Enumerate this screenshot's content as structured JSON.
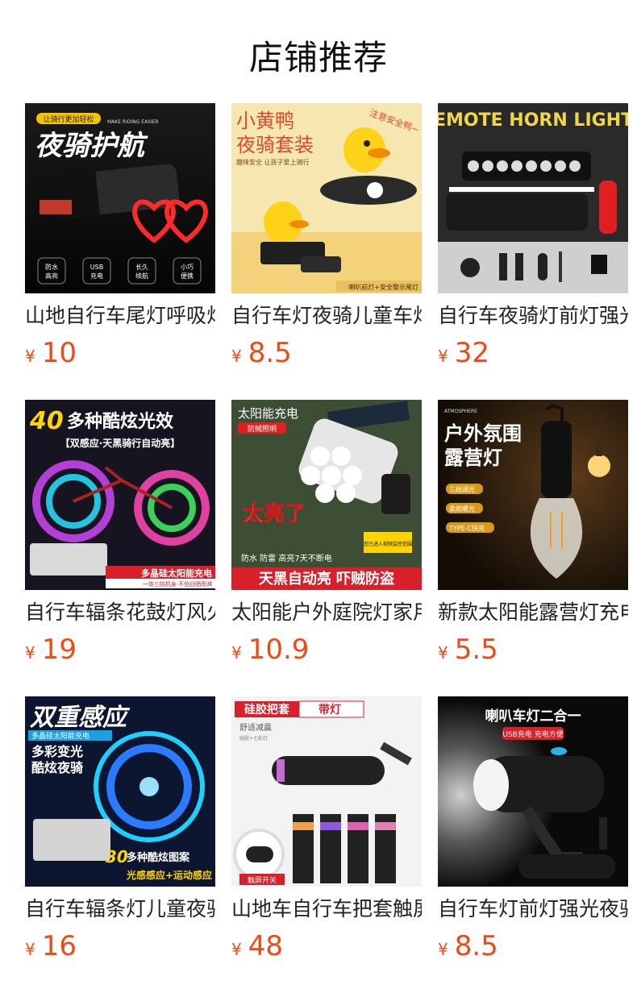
{
  "section": {
    "title": "店铺推荐"
  },
  "currency_symbol": "¥",
  "colors": {
    "price": "#ee4a14",
    "text": "#222222"
  },
  "products": [
    {
      "name": "山地自行车尾灯呼吸灯",
      "price": "10",
      "image": "bike-tail-light-photo",
      "image_text": {
        "badge": "让骑行更加轻松",
        "title": "夜骑护航",
        "sub": "MAKE RIDING EASIER",
        "f1": "防水",
        "f1b": "高亮",
        "f2": "USB",
        "f2b": "充电",
        "f3": "长久",
        "f3b": "续航",
        "f4": "小巧",
        "f4b": "便携"
      }
    },
    {
      "name": "自行车灯夜骑儿童车灯",
      "price": "8.5",
      "image": "yellow-duck-light-photo",
      "image_text": {
        "title1": "小黄鸭",
        "title2": "夜骑套装",
        "sub": "趣味安全 让孩子爱上骑行",
        "warn": "注意安全鸭~",
        "foot": "喇叭前灯+安全警示尾灯"
      }
    },
    {
      "name": "自行车夜骑灯前灯强光",
      "price": "32",
      "image": "horn-headlight-photo",
      "image_text": {
        "title": "REMOTE HORN LIGHTS"
      }
    },
    {
      "name": "自行车辐条花鼓灯风火轮",
      "price": "19",
      "image": "spoke-light-photo",
      "image_text": {
        "num": "40",
        "title": "多种酷炫光效",
        "sub": "【双感应·天黑骑行自动亮】",
        "foot": "多晶硅太阳能充电",
        "foot2": "一体三防机身·不怕日晒雨淋"
      }
    },
    {
      "name": "太阳能户外庭院灯家用",
      "price": "10.9",
      "image": "solar-security-light-photo",
      "image_text": {
        "top": "太阳能充电",
        "tag": "防贼照明",
        "big": "太亮了",
        "sign": "您已进入视频监控范围",
        "feat": "防水 防雷 高亮7天不断电",
        "foot": "天黑自动亮 吓贼防盗"
      }
    },
    {
      "name": "新款太阳能露营灯充电",
      "price": "5.5",
      "image": "camping-bulb-photo",
      "image_text": {
        "atm": "ATMOSPHERE",
        "title1": "户外氛围",
        "title2": "露营灯",
        "t1": "三档调光",
        "t2": "柔和暖光",
        "t3": "TYPE-C快充"
      }
    },
    {
      "name": "自行车辐条灯儿童夜骑",
      "price": "16",
      "image": "spoke-light-blue-photo",
      "image_text": {
        "title": "双重感应",
        "tag": "多晶硅太阳能充电",
        "sub1": "多彩变光",
        "sub2": "酷炫夜骑",
        "num": "30",
        "foot1": "多种酷炫图案",
        "foot2": "光感感应+运动感应"
      }
    },
    {
      "name": "山地车自行车把套触屏",
      "price": "48",
      "image": "grip-cover-photo",
      "image_text": {
        "t1": "硅胶把套",
        "t2": "带灯",
        "sub": "舒适减震",
        "sub2": "硅胶+七彩灯",
        "touch": "触屏开关"
      }
    },
    {
      "name": "自行车灯前灯强光夜骑",
      "price": "8.5",
      "image": "horn-light-black-photo",
      "image_text": {
        "title": "喇叭车灯二合一",
        "sub": "USB充电 充电方便"
      }
    }
  ]
}
